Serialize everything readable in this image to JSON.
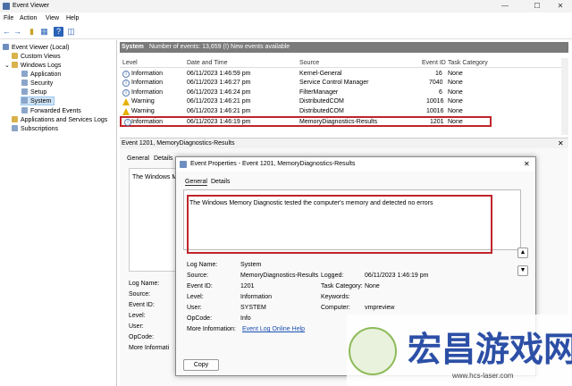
{
  "window": {
    "title": "Event Viewer",
    "min": "—",
    "max": "☐",
    "close": "✕"
  },
  "menu": [
    "File",
    "Action",
    "View",
    "Help"
  ],
  "tree": {
    "root": "Event Viewer (Local)",
    "custom_views": "Custom Views",
    "windows_logs": "Windows Logs",
    "application": "Application",
    "security": "Security",
    "setup": "Setup",
    "system": "System",
    "forwarded": "Forwarded Events",
    "apps_services": "Applications and Services Logs",
    "subscriptions": "Subscriptions"
  },
  "log_header": {
    "name": "System",
    "count": "Number of events: 13,659 (!) New events available"
  },
  "columns": {
    "level": "Level",
    "date": "Date and Time",
    "source": "Source",
    "event_id": "Event ID",
    "task": "Task Category"
  },
  "events": [
    {
      "level": "Information",
      "date": "06/11/2023 1:46:59 pm",
      "source": "Kernel-General",
      "id": "16",
      "task": "None"
    },
    {
      "level": "Information",
      "date": "06/11/2023 1:46:27 pm",
      "source": "Service Control Manager",
      "id": "7040",
      "task": "None"
    },
    {
      "level": "Information",
      "date": "06/11/2023 1:46:24 pm",
      "source": "FilterManager",
      "id": "6",
      "task": "None"
    },
    {
      "level": "Warning",
      "date": "06/11/2023 1:46:21 pm",
      "source": "DistributedCOM",
      "id": "10016",
      "task": "None"
    },
    {
      "level": "Warning",
      "date": "06/11/2023 1:46:21 pm",
      "source": "DistributedCOM",
      "id": "10016",
      "task": "None"
    },
    {
      "level": "Information",
      "date": "06/11/2023 1:46:19 pm",
      "source": "MemoryDiagnostics-Results",
      "id": "1201",
      "task": "None"
    }
  ],
  "detail_header": "Event 1201, MemoryDiagnostics-Results",
  "lower_tabs": {
    "general": "General",
    "details": "Details"
  },
  "lower_preview": "The Windows M",
  "lower_labels": {
    "log_name": "Log Name:",
    "source": "Source:",
    "event_id": "Event ID:",
    "level": "Level:",
    "user": "User:",
    "opcode": "OpCode:",
    "more_info": "More Informati"
  },
  "dialog": {
    "title": "Event Properties - Event 1201, MemoryDiagnostics-Results",
    "tab_general": "General",
    "tab_details": "Details",
    "message": "The Windows Memory Diagnostic tested the computer's memory and detected no errors",
    "log_name_label": "Log Name:",
    "log_name": "System",
    "source_label": "Source:",
    "source": "MemoryDiagnostics-Results",
    "logged_label": "Logged:",
    "logged": "06/11/2023 1:46:19 pm",
    "event_id_label": "Event ID:",
    "event_id": "1201",
    "task_label": "Task Category:",
    "task": "None",
    "level_label": "Level:",
    "level": "Information",
    "keywords_label": "Keywords:",
    "user_label": "User:",
    "user": "SYSTEM",
    "computer_label": "Computer:",
    "computer": "vmpreview",
    "opcode_label": "OpCode:",
    "opcode": "Info",
    "more_info_label": "More Information:",
    "more_info_link": "Event Log Online Help",
    "copy": "Copy"
  },
  "watermark": {
    "text": "宏昌游戏网",
    "url": "www.hcs-laser.com"
  },
  "colors": {
    "accent": "#2a62b8",
    "highlight": "#c0242c",
    "warning": "#e6b000"
  }
}
